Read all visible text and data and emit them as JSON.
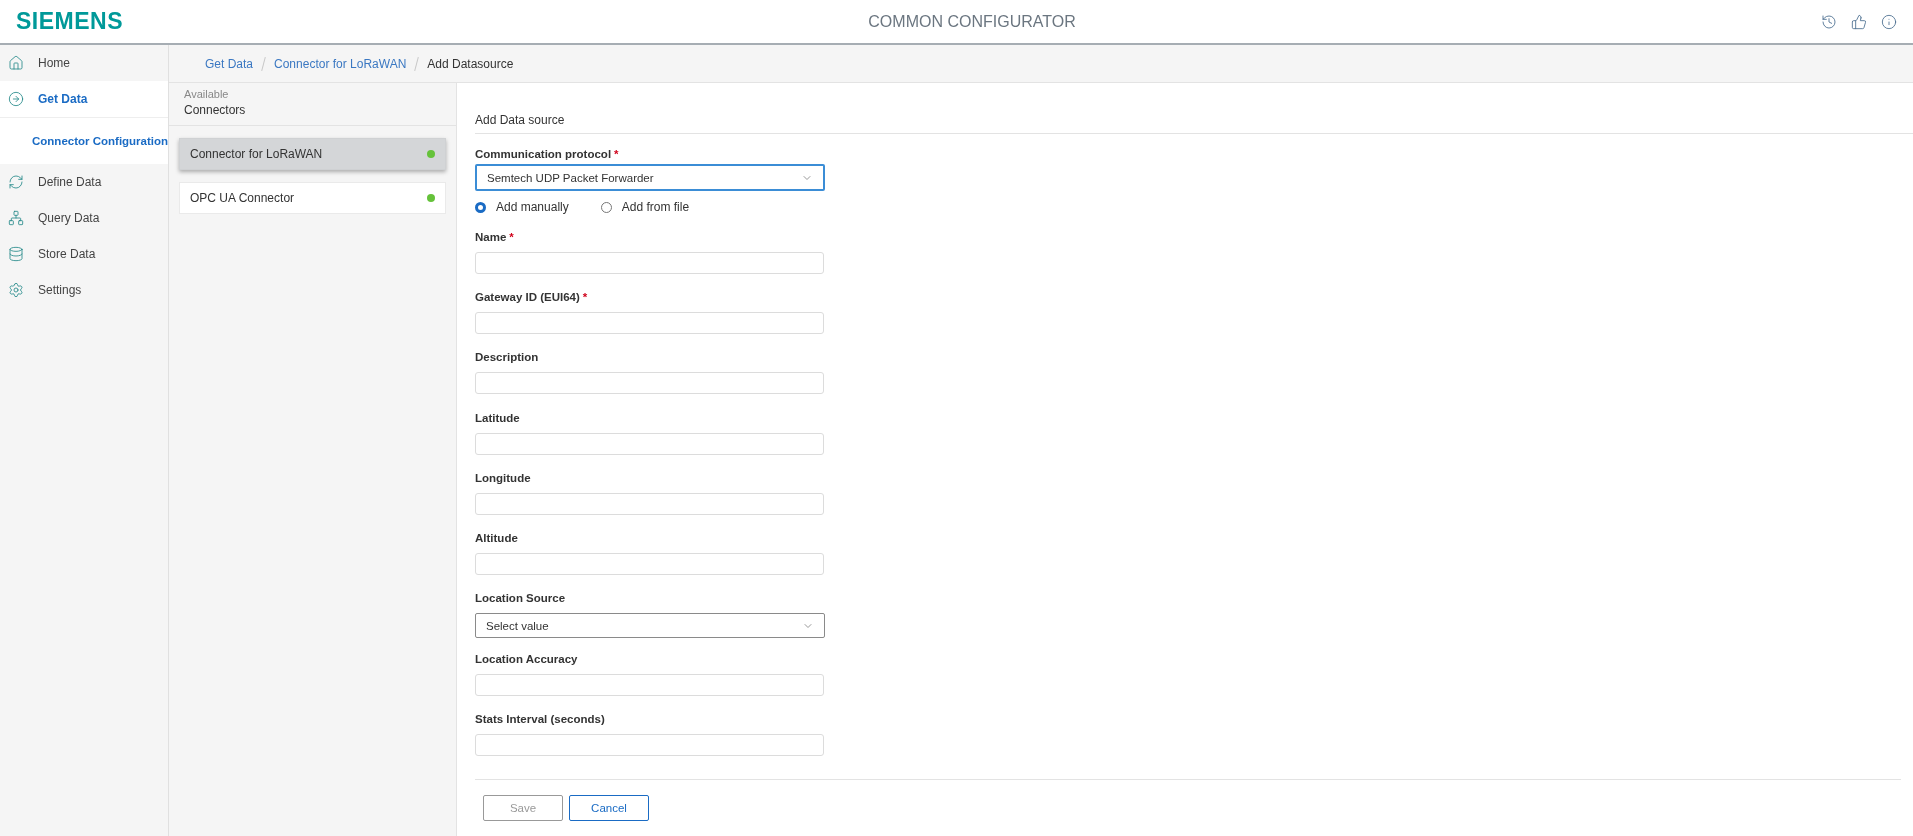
{
  "header": {
    "logo": "SIEMENS",
    "title": "COMMON CONFIGURATOR"
  },
  "sidebar": {
    "items": [
      {
        "label": "Home",
        "selected": false
      },
      {
        "label": "Get Data",
        "selected": true,
        "children": [
          {
            "label": "Connector Configuration",
            "selected": true
          }
        ]
      },
      {
        "label": "Define Data",
        "selected": false
      },
      {
        "label": "Query Data",
        "selected": false
      },
      {
        "label": "Store Data",
        "selected": false
      },
      {
        "label": "Settings",
        "selected": false
      }
    ]
  },
  "breadcrumb": [
    {
      "label": "Get Data",
      "link": true
    },
    {
      "label": "Connector for LoRaWAN",
      "link": true
    },
    {
      "label": "Add Datasource",
      "link": false
    }
  ],
  "connectors": {
    "caption": "Available",
    "title": "Connectors",
    "items": [
      {
        "name": "Connector for LoRaWAN",
        "selected": true,
        "color": "#65c23a"
      },
      {
        "name": "OPC UA Connector",
        "selected": false,
        "color": "#65c23a"
      }
    ]
  },
  "form": {
    "title": "Add Data source",
    "protocol": {
      "label": "Communication protocol",
      "required_mark": "*",
      "value": "Semtech UDP Packet Forwarder"
    },
    "radios": [
      {
        "label": "Add manually",
        "selected": true
      },
      {
        "label": "Add from file",
        "selected": false
      }
    ],
    "fields": [
      {
        "label": "Name",
        "required_mark": "*",
        "kind": "text"
      },
      {
        "label": "Gateway ID (EUI64)",
        "required_mark": "*",
        "kind": "text"
      },
      {
        "label": "Description",
        "kind": "text"
      },
      {
        "label": "Latitude",
        "kind": "text"
      },
      {
        "label": "Longitude",
        "kind": "text"
      },
      {
        "label": "Altitude",
        "kind": "text"
      },
      {
        "label": "Location Source",
        "kind": "select",
        "value": "Select value"
      },
      {
        "label": "Location Accuracy",
        "kind": "text"
      },
      {
        "label": "Stats Interval (seconds)",
        "kind": "text"
      }
    ],
    "buttons": [
      {
        "label": "Save",
        "disabled": true
      },
      {
        "label": "Cancel",
        "disabled": false
      }
    ]
  }
}
